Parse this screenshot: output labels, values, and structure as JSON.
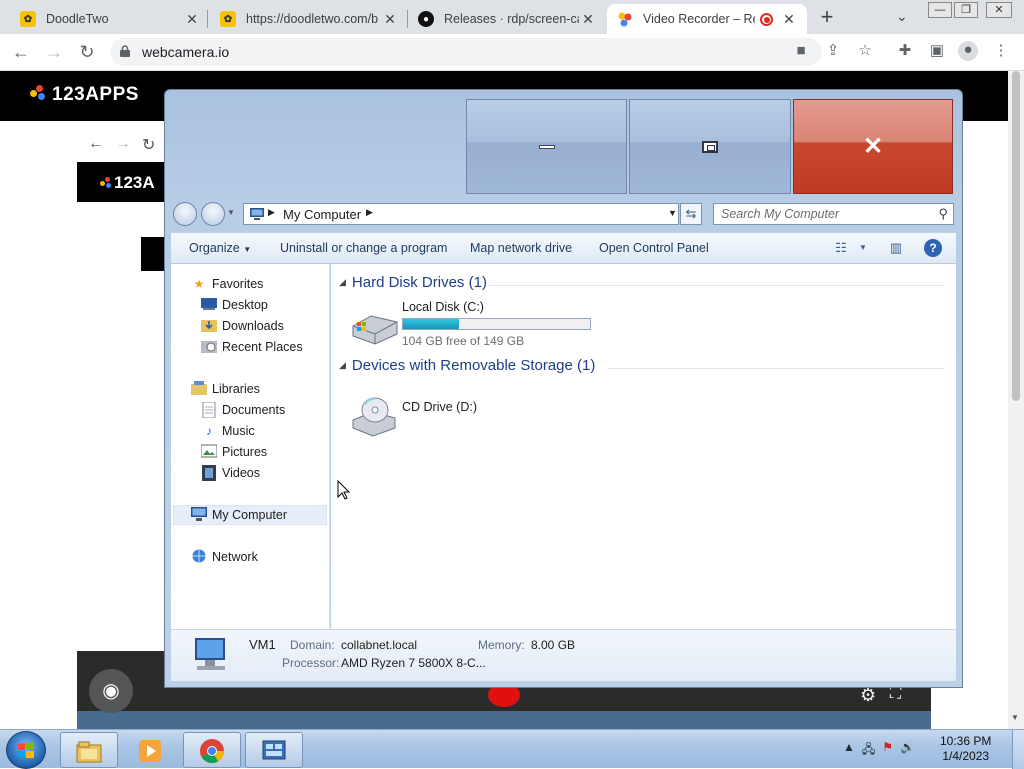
{
  "browser": {
    "tabs": [
      {
        "title": "DoodleTwo",
        "close": "✕"
      },
      {
        "title": "https://doodletwo.com/b",
        "close": "✕"
      },
      {
        "title": "Releases · rdp/screen-cap",
        "close": "✕"
      },
      {
        "title": "Video Recorder – Rec",
        "close": "✕"
      }
    ],
    "new_tab": "+",
    "url": "webcamera.io"
  },
  "page": {
    "brand": "123APPS",
    "inner_brand": "123A"
  },
  "explorer": {
    "address": {
      "crumb": "My Computer"
    },
    "search_placeholder": "Search My Computer",
    "commands": {
      "organize": "Organize",
      "uninstall": "Uninstall or change a program",
      "map_drive": "Map network drive",
      "control_panel": "Open Control Panel"
    },
    "nav": {
      "favorites": "Favorites",
      "desktop": "Desktop",
      "downloads": "Downloads",
      "recent": "Recent Places",
      "libraries": "Libraries",
      "documents": "Documents",
      "music": "Music",
      "pictures": "Pictures",
      "videos": "Videos",
      "my_computer": "My Computer",
      "network": "Network"
    },
    "groups": {
      "hard_disks": "Hard Disk Drives (1)",
      "removable": "Devices with Removable Storage (1)"
    },
    "drives": {
      "c_name": "Local Disk (C:)",
      "c_free": "104 GB free of 149 GB",
      "c_used_fraction": 0.3,
      "d_name": "CD Drive (D:)"
    },
    "details": {
      "name": "VM1",
      "domain_label": "Domain:",
      "domain": "collabnet.local",
      "memory_label": "Memory:",
      "memory": "8.00 GB",
      "processor_label": "Processor:",
      "processor": "AMD Ryzen 7 5800X 8-C..."
    }
  },
  "taskbar": {
    "time": "10:36 PM",
    "date": "1/4/2023"
  },
  "colors": {
    "explorer_link": "#1e3f87",
    "close_red": "#c03b25",
    "drive_bar": "#1a93b7"
  }
}
